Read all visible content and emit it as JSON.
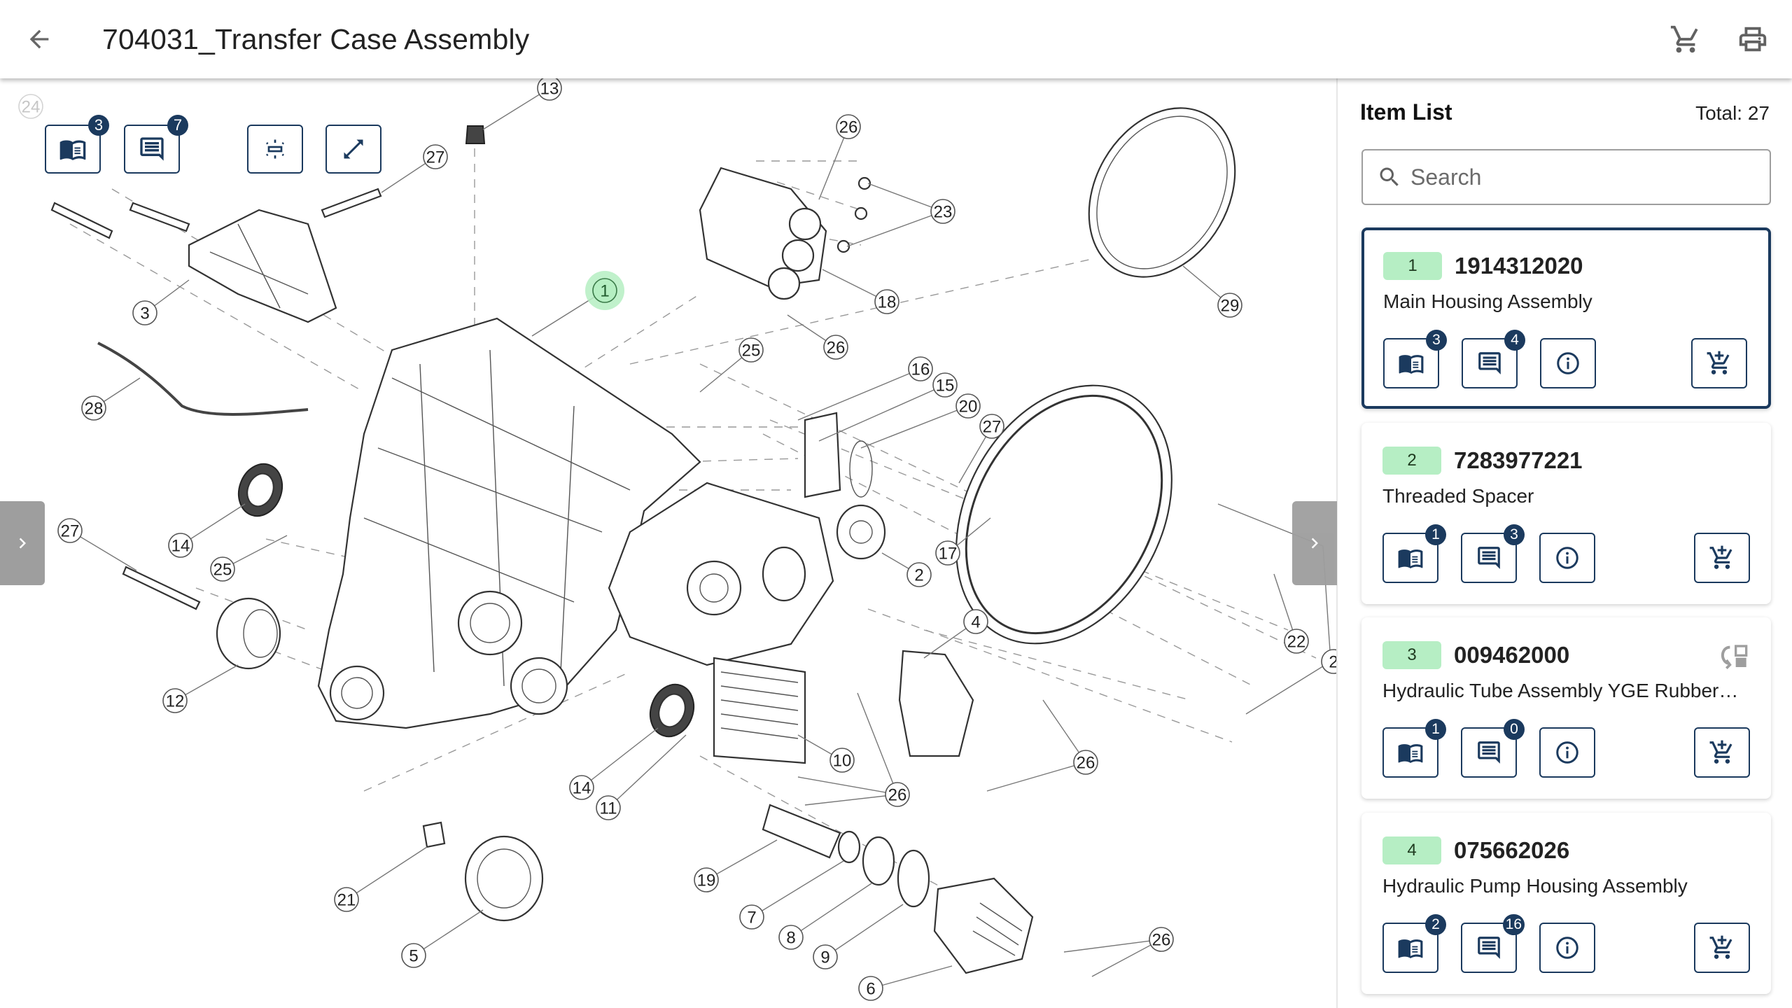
{
  "header": {
    "title": "704031_Transfer Case Assembly",
    "back_icon": "arrow-back-icon",
    "cart_icon": "shopping-cart-icon",
    "print_icon": "printer-icon"
  },
  "toolbar": {
    "manuals_count": "3",
    "notes_count": "7",
    "manuals_icon": "book-open-icon",
    "notes_icon": "comment-icon",
    "fit_icon": "fit-to-screen-icon",
    "expand_icon": "expand-diagonal-icon"
  },
  "drawing": {
    "selected_callout": "1",
    "callouts": [
      {
        "label": "24",
        "faded": true
      },
      {
        "label": "13"
      },
      {
        "label": "27"
      },
      {
        "label": "26"
      },
      {
        "label": "23"
      },
      {
        "label": "18"
      },
      {
        "label": "26"
      },
      {
        "label": "29"
      },
      {
        "label": "1",
        "selected": true
      },
      {
        "label": "3"
      },
      {
        "label": "28"
      },
      {
        "label": "25"
      },
      {
        "label": "16"
      },
      {
        "label": "15"
      },
      {
        "label": "20"
      },
      {
        "label": "27"
      },
      {
        "label": "27"
      },
      {
        "label": "14"
      },
      {
        "label": "25"
      },
      {
        "label": "17"
      },
      {
        "label": "2"
      },
      {
        "label": "4"
      },
      {
        "label": "22"
      },
      {
        "label": "2"
      },
      {
        "label": "12"
      },
      {
        "label": "10"
      },
      {
        "label": "26"
      },
      {
        "label": "14"
      },
      {
        "label": "11"
      },
      {
        "label": "26"
      },
      {
        "label": "19"
      },
      {
        "label": "21"
      },
      {
        "label": "7"
      },
      {
        "label": "8"
      },
      {
        "label": "9"
      },
      {
        "label": "5"
      },
      {
        "label": "6"
      },
      {
        "label": "26"
      }
    ]
  },
  "nav": {
    "prev_icon": "chevron-right-icon",
    "next_icon": "chevron-right-icon"
  },
  "sidebar": {
    "title": "Item List",
    "total": "Total: 27",
    "search_placeholder": "Search",
    "search_value": "",
    "items": [
      {
        "position": "1",
        "part_number": "1914312020",
        "description": "Main Housing Assembly",
        "manuals": "3",
        "notes": "4",
        "selected": true,
        "has_substitute": false
      },
      {
        "position": "2",
        "part_number": "7283977221",
        "description": "Threaded Spacer",
        "manuals": "1",
        "notes": "3",
        "selected": false,
        "has_substitute": false
      },
      {
        "position": "3",
        "part_number": "009462000",
        "description": "Hydraulic Tube Assembly YGE Rubber…",
        "manuals": "1",
        "notes": "0",
        "selected": false,
        "has_substitute": true
      },
      {
        "position": "4",
        "part_number": "075662026",
        "description": "Hydraulic Pump Housing Assembly",
        "manuals": "2",
        "notes": "16",
        "selected": false,
        "has_substitute": false
      }
    ]
  },
  "colors": {
    "primary": "#1b3a5e",
    "position_badge": "#b6eec4",
    "highlight": "#b5efc2",
    "nav_panel": "#9e9e9e"
  }
}
